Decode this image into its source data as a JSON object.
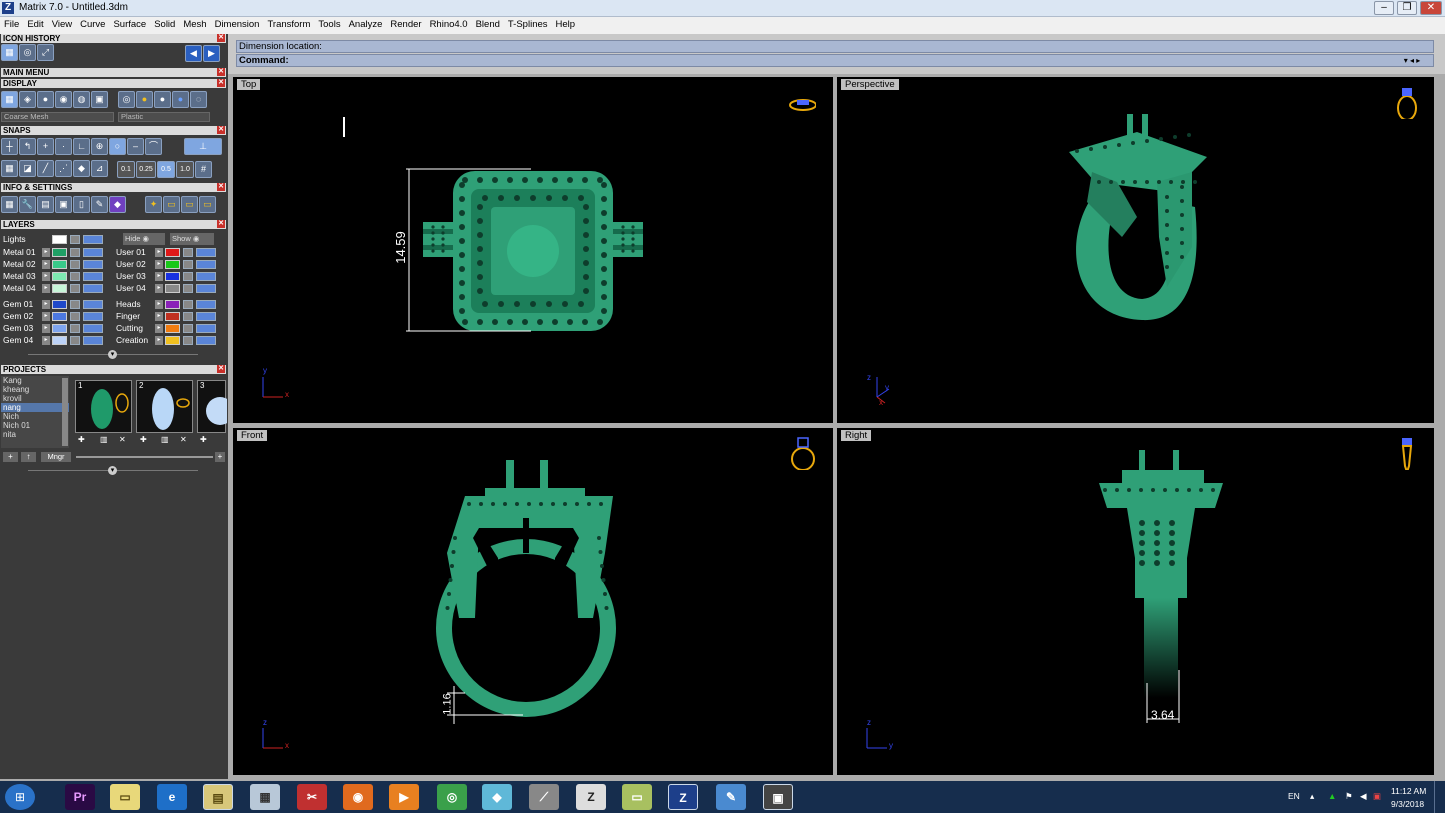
{
  "window": {
    "title": "Matrix 7.0 - Untitled.3dm",
    "app_letter": "Z"
  },
  "menu": [
    "File",
    "Edit",
    "View",
    "Curve",
    "Surface",
    "Solid",
    "Mesh",
    "Dimension",
    "Transform",
    "Tools",
    "Analyze",
    "Render",
    "Rhino4.0",
    "Blend",
    "T-Splines",
    "Help"
  ],
  "panels": {
    "icon_history": "ICON HISTORY",
    "main_menu": "MAIN MENU",
    "display": "DISPLAY",
    "snaps": "SNAPS",
    "info_settings": "INFO & SETTINGS",
    "layers": "LAYERS",
    "projects": "PROJECTS"
  },
  "display": {
    "mesh_option": "Coarse Mesh",
    "material_option": "Plastic"
  },
  "snaps": {
    "values": [
      "0.1",
      "0.25",
      "0.5",
      "1.0"
    ]
  },
  "layers": {
    "lights": "Lights",
    "hide": "Hide",
    "show": "Show",
    "left": [
      {
        "name": "Metal 01",
        "color": "#1fa065"
      },
      {
        "name": "Metal 02",
        "color": "#39c88a"
      },
      {
        "name": "Metal 03",
        "color": "#7de8b0"
      },
      {
        "name": "Metal 04",
        "color": "#c7f5d8"
      },
      {
        "name": "Gem 01",
        "color": "#2049c8"
      },
      {
        "name": "Gem 02",
        "color": "#4c78e0"
      },
      {
        "name": "Gem 03",
        "color": "#7ea4ee"
      },
      {
        "name": "Gem 04",
        "color": "#bcd2f7"
      }
    ],
    "right": [
      {
        "name": "User 01",
        "color": "#e01818"
      },
      {
        "name": "User 02",
        "color": "#18c818"
      },
      {
        "name": "User 03",
        "color": "#1830e0"
      },
      {
        "name": "User 04",
        "color": "#888888"
      },
      {
        "name": "Heads",
        "color": "#8a20b8"
      },
      {
        "name": "Finger",
        "color": "#c03020"
      },
      {
        "name": "Cutting",
        "color": "#f07c10"
      },
      {
        "name": "Creation",
        "color": "#f0c020"
      }
    ]
  },
  "projects": {
    "names": [
      "Kang",
      "kheang",
      "krovil",
      "nang",
      "Nich",
      "Nich 01",
      "nita"
    ],
    "selected": "nang",
    "thumb_numbers": [
      "1",
      "2",
      "3"
    ],
    "mngr": "Mngr"
  },
  "command": {
    "prompt_line": "Dimension location:",
    "label": "Command:"
  },
  "viewports": [
    {
      "name": "Top",
      "dimension": "14.59",
      "axes": [
        "y",
        "x"
      ]
    },
    {
      "name": "Perspective",
      "axes": [
        "z",
        "y",
        "x"
      ]
    },
    {
      "name": "Front",
      "dimension": "1.16",
      "axes": [
        "z",
        "x"
      ]
    },
    {
      "name": "Right",
      "dimension": "3.64",
      "axes": [
        "z",
        "y"
      ]
    }
  ],
  "colors": {
    "model_green": "#2fa077",
    "navcube_gold": "#e8a80c",
    "axis_x": "#cc2222",
    "axis_y": "#3344ee",
    "axis_z": "#3344ee",
    "viewport_bg": "#000000"
  },
  "taskbar": {
    "apps": [
      "start-orb",
      "premiere-pro",
      "file-explorer-folder",
      "internet-explorer",
      "file-manager",
      "calculator",
      "snipping-tool",
      "firefox",
      "media-player",
      "chrome",
      "sketch-tool",
      "brush-tool",
      "zbrush",
      "notepad",
      "matrix-z",
      "paint",
      "photo-viewer"
    ],
    "premiere_label": "Pr",
    "lang": "EN",
    "time": "11:12 AM",
    "date": "9/3/2018"
  }
}
